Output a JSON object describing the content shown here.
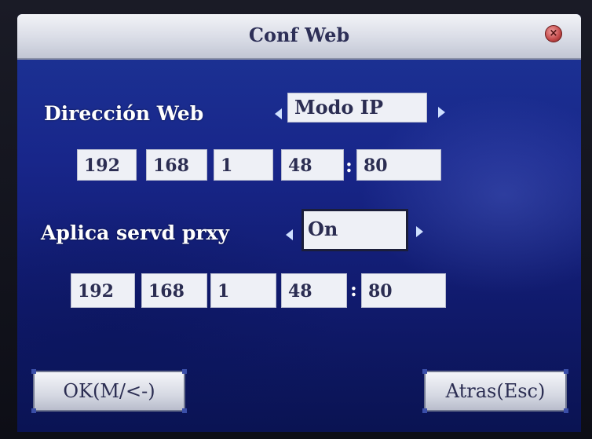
{
  "window": {
    "title": "Conf Web"
  },
  "web_address": {
    "label": "Dirección Web",
    "mode_value": "Modo IP",
    "ip": [
      "192",
      "168",
      "1",
      "48"
    ],
    "port": "80"
  },
  "proxy": {
    "label": "Aplica servd prxy",
    "enabled_value": "On",
    "ip": [
      "192",
      "168",
      "1",
      "48"
    ],
    "port": "80"
  },
  "buttons": {
    "ok_label": "OK(M/<-)",
    "back_label": "Atras(Esc)"
  },
  "separator": ":",
  "colors": {
    "title_bar": "#d9dce6",
    "screen_bg": "#18268a",
    "field_bg": "#eef0f6",
    "close_button": "#c24848"
  },
  "icons": [
    "close-icon",
    "arrow-left-icon",
    "arrow-right-icon"
  ]
}
